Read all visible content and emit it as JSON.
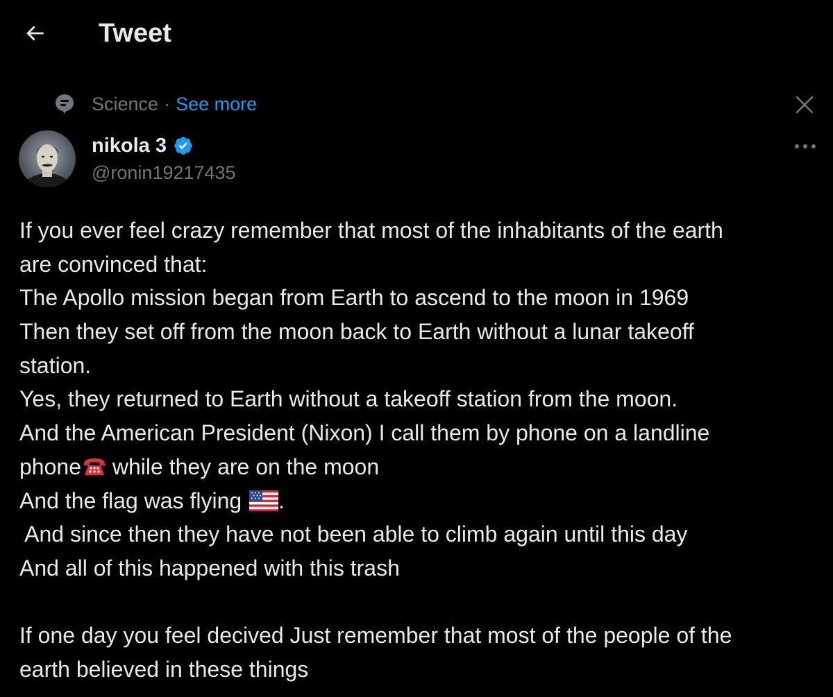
{
  "header": {
    "back_icon": "arrow-left-icon",
    "title": "Tweet"
  },
  "topic": {
    "icon": "topic-bubble-icon",
    "label": "Science",
    "separator": "·",
    "see_more": "See more",
    "close_icon": "close-x-icon"
  },
  "author": {
    "avatar_icon": "avatar-portrait",
    "display_name": "nikola 3",
    "verified_icon": "verified-badge-icon",
    "handle": "@ronin19217435",
    "more_icon": "more-dots-icon"
  },
  "tweet": {
    "lines": [
      "If you ever feel crazy remember that most of the inhabitants of the earth",
      "are convinced that:",
      "The Apollo mission began from Earth to ascend to the moon in 1969",
      "Then they set off from the moon back to Earth without a lunar takeoff",
      "station.",
      "Yes, they returned to Earth without a takeoff station from the moon.",
      "And the American President (Nixon) I call them by phone on a landline",
      "phone",
      " while they are on the moon",
      "And the flag was flying ",
      ".",
      " And since then they have not been able to climb again until this day",
      "And all of this happened with this trash",
      "",
      "If one day you feel decived Just remember that most of the people of the",
      "earth believed in these things"
    ],
    "emojis": {
      "phone": "telephone-emoji",
      "flag": "us-flag-emoji"
    }
  },
  "colors": {
    "background": "#000000",
    "text": "#e7e9ea",
    "secondary": "#71767b",
    "accent": "#1d9bf0"
  }
}
